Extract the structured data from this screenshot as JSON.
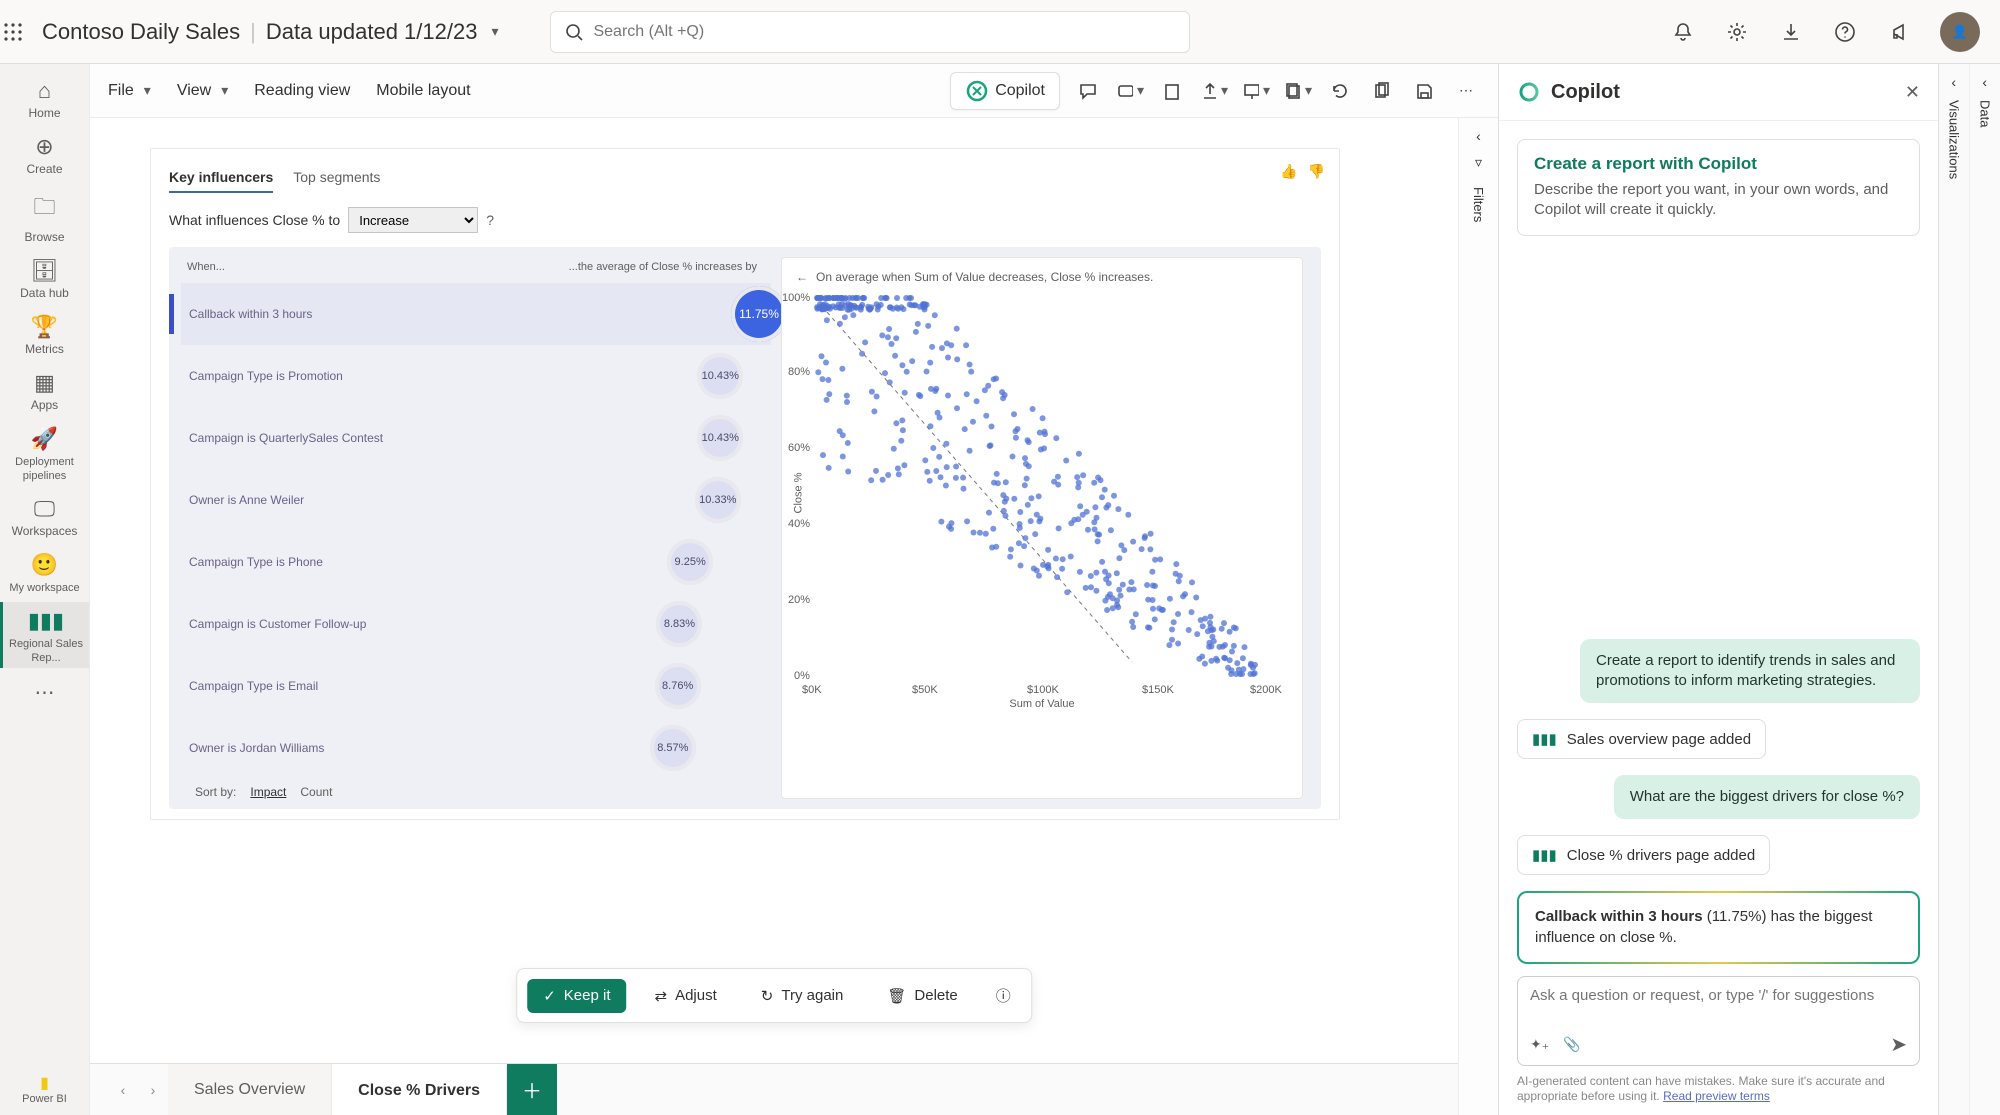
{
  "header": {
    "app_title": "Contoso Daily Sales",
    "subtitle": "Data updated 1/12/23",
    "search_placeholder": "Search (Alt +Q)"
  },
  "leftnav": {
    "items": [
      {
        "label": "Home"
      },
      {
        "label": "Create"
      },
      {
        "label": "Browse"
      },
      {
        "label": "Data hub"
      },
      {
        "label": "Metrics"
      },
      {
        "label": "Apps"
      },
      {
        "label": "Deployment pipelines"
      },
      {
        "label": "Workspaces"
      },
      {
        "label": "My workspace"
      },
      {
        "label": "Regional Sales Rep..."
      }
    ],
    "footer": "Power BI"
  },
  "ribbon": {
    "menus": [
      "File",
      "View",
      "Reading view",
      "Mobile layout"
    ],
    "copilot": "Copilot"
  },
  "visual": {
    "tabs": [
      "Key influencers",
      "Top segments"
    ],
    "question_prefix": "What influences Close % to",
    "direction_options": [
      "Increase"
    ],
    "when_label": "When...",
    "increase_label": "...the average of Close % increases by",
    "sort_label": "Sort by:",
    "sort_options": [
      "Impact",
      "Count"
    ],
    "scatter_back_title": "On average when Sum of Value decreases, Close % increases.",
    "xaxis": "Sum of Value",
    "yaxis": "Close %"
  },
  "chart_data": {
    "type": "bar",
    "title": "Key influencers — average Close % increase",
    "categories": [
      "Callback within 3 hours",
      "Campaign Type is Promotion",
      "Campaign is QuarterlySales Contest",
      "Owner is Anne Weiler",
      "Campaign Type is Phone",
      "Campaign is Customer Follow-up",
      "Campaign Type is Email",
      "Owner is Jordan Williams"
    ],
    "values": [
      11.75,
      10.43,
      10.43,
      10.33,
      9.25,
      8.83,
      8.76,
      8.57
    ],
    "value_suffix": "%",
    "selected_index": 0,
    "scatter": {
      "type": "scatter",
      "xlabel": "Sum of Value",
      "ylabel": "Close %",
      "x_ticks": [
        "$0K",
        "$50K",
        "$100K",
        "$150K",
        "$200K"
      ],
      "y_ticks": [
        "0%",
        "20%",
        "40%",
        "60%",
        "80%",
        "100%"
      ],
      "xlim": [
        0,
        210000
      ],
      "ylim": [
        0,
        100
      ],
      "trend_note": "negative trend line from (~10K, ~95%) to (~140K, ~5%)"
    }
  },
  "actions": {
    "keep": "Keep it",
    "adjust": "Adjust",
    "try": "Try again",
    "delete": "Delete"
  },
  "pagetabs": [
    "Sales Overview",
    "Close % Drivers"
  ],
  "filters_label": "Filters",
  "right_rails": [
    "Visualizations",
    "Data"
  ],
  "copilot": {
    "title": "Copilot",
    "card_title": "Create a report with Copilot",
    "card_sub": "Describe the report you want, in your own words, and Copilot will create it quickly.",
    "msg1": "Create a report to identify trends in sales and promotions to inform marketing strategies.",
    "chip1": "Sales overview page added",
    "msg2": "What are the biggest drivers for close %?",
    "chip2": "Close % drivers page added",
    "highlight_lead": "Callback within 3 hours",
    "highlight_value": "(11.75%)",
    "highlight_rest": " has the biggest influence on close %.",
    "input_placeholder": "Ask a question or request, or type '/' for suggestions",
    "disclaimer": "AI-generated content can have mistakes. Make sure it's accurate and appropriate before using it.",
    "disclaimer_link": "Read preview terms"
  }
}
